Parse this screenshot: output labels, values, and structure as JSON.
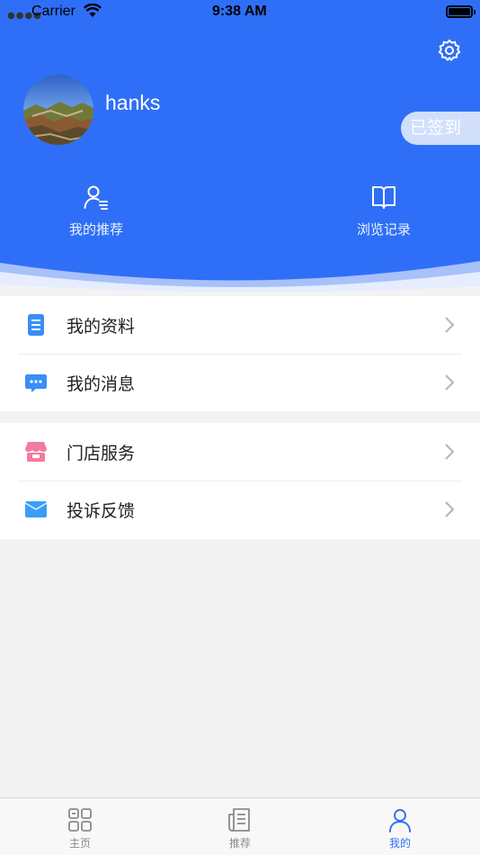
{
  "status_bar": {
    "carrier": "Carrier",
    "time": "9:38 AM"
  },
  "profile": {
    "username": "hanks",
    "signed_badge": "已签到"
  },
  "quick_actions": [
    {
      "label": "我的推荐",
      "icon": "user-list-icon"
    },
    {
      "label": "浏览记录",
      "icon": "open-book-icon"
    }
  ],
  "menu": {
    "group1": [
      {
        "label": "我的资料",
        "icon": "document-icon",
        "color": "#3a8ef6"
      },
      {
        "label": "我的消息",
        "icon": "chat-bubble-icon",
        "color": "#3a8ef6"
      }
    ],
    "group2": [
      {
        "label": "门店服务",
        "icon": "store-icon",
        "color": "#f47ba0"
      },
      {
        "label": "投诉反馈",
        "icon": "envelope-icon",
        "color": "#3a9ef6"
      }
    ]
  },
  "tabbar": [
    {
      "label": "主页",
      "icon": "grid-home-icon",
      "active": false
    },
    {
      "label": "推荐",
      "icon": "newspaper-icon",
      "active": false
    },
    {
      "label": "我的",
      "icon": "person-icon",
      "active": true
    }
  ],
  "colors": {
    "primary": "#2f6ff7",
    "background": "#f3f3f4"
  }
}
